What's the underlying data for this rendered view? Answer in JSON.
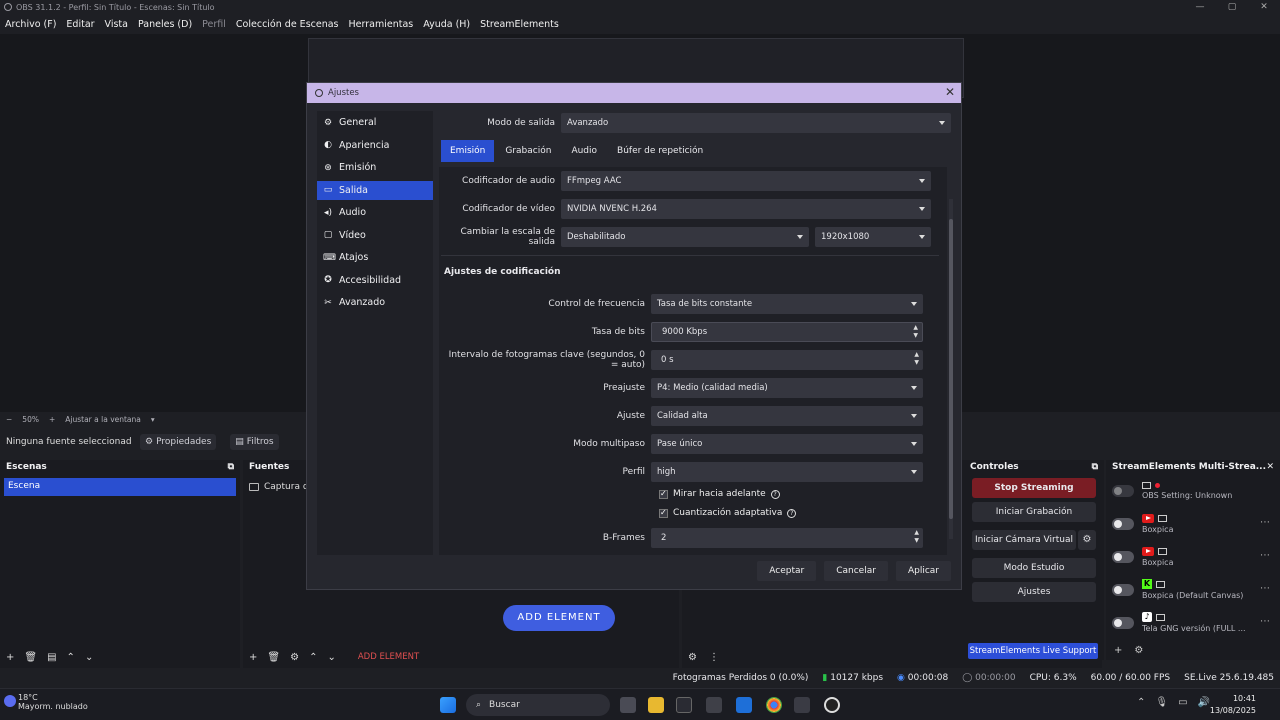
{
  "window": {
    "title": "OBS 31.1.2 - Perfil: Sin Título - Escenas: Sin Título",
    "controls": [
      "—",
      "▢",
      "✕"
    ]
  },
  "menu": {
    "items": [
      "Archivo (F)",
      "Editar",
      "Vista",
      "Paneles (D)",
      "Perfil",
      "Colección de Escenas",
      "Herramientas",
      "Ayuda (H)",
      "StreamElements"
    ]
  },
  "zoom": {
    "level": "50%",
    "fit": "Ajustar a la ventana"
  },
  "source_toolbar": {
    "no_source": "Ninguna fuente seleccionad",
    "properties": "Propiedades",
    "filters": "Filtros"
  },
  "scenes": {
    "title": "Escenas",
    "items": [
      "Escena"
    ]
  },
  "sources": {
    "title": "Fuentes",
    "items": [
      "Captura de"
    ],
    "add_element": "ADD ELEMENT"
  },
  "controls": {
    "title": "Controles",
    "stop_streaming": "Stop Streaming",
    "start_recording": "Iniciar Grabación",
    "virtual_camera": "Iniciar Cámara Virtual",
    "studio_mode": "Modo Estudio",
    "settings": "Ajustes"
  },
  "multistream": {
    "title": "StreamElements Multi-Strea...",
    "rows": [
      {
        "label": "OBS Setting: Unknown"
      },
      {
        "label": "Boxpica"
      },
      {
        "label": "Boxpica"
      },
      {
        "label": "Boxpica (Default Canvas)"
      },
      {
        "label": "Tela GNG versión (FULL ..."
      }
    ],
    "support": "StreamElements Live Support"
  },
  "add_element_center": "ADD ELEMENT",
  "status": {
    "dropped": "Fotogramas Perdidos 0 (0.0%)",
    "bitrate": "10127 kbps",
    "stream_time": "00:00:08",
    "rec_time": "00:00:00",
    "cpu": "CPU: 6.3%",
    "fps": "60.00 / 60.00 FPS",
    "version": "SE.Live 25.6.19.485"
  },
  "taskbar": {
    "temp": "18°C",
    "weather": "Mayorm. nublado",
    "search": "Buscar",
    "time": "10:41",
    "date": "13/08/2025"
  },
  "dialog": {
    "title": "Ajustes",
    "sidebar": [
      {
        "label": "General",
        "icon": "⚙"
      },
      {
        "label": "Apariencia",
        "icon": "🎨"
      },
      {
        "label": "Emisión",
        "icon": "📡"
      },
      {
        "label": "Salida",
        "icon": "▭"
      },
      {
        "label": "Audio",
        "icon": "🔊"
      },
      {
        "label": "Vídeo",
        "icon": "▭"
      },
      {
        "label": "Atajos",
        "icon": "⌨"
      },
      {
        "label": "Accesibilidad",
        "icon": "◉"
      },
      {
        "label": "Avanzado",
        "icon": "✂"
      }
    ],
    "output_mode_label": "Modo de salida",
    "output_mode": "Avanzado",
    "tabs": [
      "Emisión",
      "Grabación",
      "Audio",
      "Búfer de repetición"
    ],
    "audio_encoder_label": "Codificador de audio",
    "audio_encoder": "FFmpeg AAC",
    "video_encoder_label": "Codificador de vídeo",
    "video_encoder": "NVIDIA NVENC H.264",
    "rescale_label": "Cambiar la escala de salida",
    "rescale": "Deshabilitado",
    "rescale_res": "1920x1080",
    "encoding_section": "Ajustes de codificación",
    "rate_control_label": "Control de frecuencia",
    "rate_control": "Tasa de bits constante",
    "bitrate_label": "Tasa de bits",
    "bitrate": "9000 Kbps",
    "keyframe_label": "Intervalo de fotogramas clave (segundos, 0 = auto)",
    "keyframe": "0 s",
    "preset_label": "Preajuste",
    "preset": "P4: Medio (calidad media)",
    "tuning_label": "Ajuste",
    "tuning": "Calidad alta",
    "multipass_label": "Modo multipaso",
    "multipass": "Pase único",
    "profile_label": "Perfil",
    "profile": "high",
    "lookahead": "Mirar hacia adelante",
    "adaptive_quant": "Cuantización adaptativa",
    "bframes_label": "B-Frames",
    "bframes": "2",
    "buttons": {
      "accept": "Aceptar",
      "cancel": "Cancelar",
      "apply": "Aplicar"
    }
  }
}
